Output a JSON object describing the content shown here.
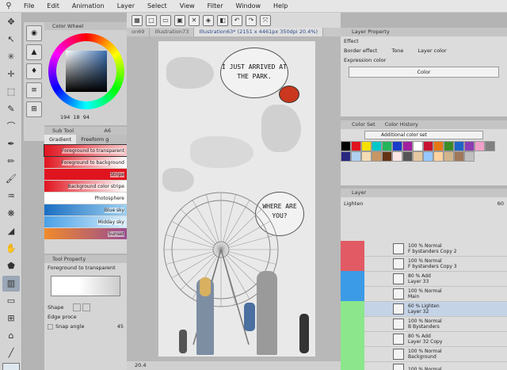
{
  "menubar": {
    "items": [
      "File",
      "Edit",
      "Animation",
      "Layer",
      "Select",
      "View",
      "Filter",
      "Window",
      "Help"
    ]
  },
  "canvas_tabs": [
    "on69",
    "Illustration73",
    "Illustration63* (2151 x 4461px 350dpi 20.4%)"
  ],
  "color_wheel": {
    "title": "Color Wheel",
    "h": "194",
    "s": "18",
    "v": "94"
  },
  "sub_tool": {
    "title": "Sub Tool",
    "tab_label": "A6",
    "tabs": [
      "Gradient",
      "Freeform g"
    ],
    "items": [
      {
        "label": "Foreground to transparent",
        "colors": [
          "#e0141e",
          "#f6c6c8"
        ]
      },
      {
        "label": "Foreground to background",
        "colors": [
          "#e0141e",
          "#ffffff"
        ]
      },
      {
        "label": "Stripe",
        "colors": [
          "#e0141e",
          "#e0141e"
        ]
      },
      {
        "label": "Background color stripe",
        "colors": [
          "#e0141e",
          "#ffffff"
        ]
      },
      {
        "label": "Photosphere",
        "colors": [
          "#ffffff",
          "#ffffff"
        ]
      },
      {
        "label": "Blue sky",
        "colors": [
          "#1a6fc2",
          "#9ed0f0"
        ]
      },
      {
        "label": "Midday sky",
        "colors": [
          "#4aa0e6",
          "#d8eefb"
        ]
      },
      {
        "label": "Sunset",
        "colors": [
          "#f08a2c",
          "#9a4c90"
        ]
      }
    ]
  },
  "tool_property": {
    "title": "Tool Property",
    "preset": "Foreground to transparent",
    "shape_label": "Shape",
    "edge_label": "Edge proce",
    "snap_label": "Snap angle",
    "snap_value": "45"
  },
  "layer_property": {
    "title": "Layer Property",
    "effect_label": "Effect",
    "border_effect": "Border effect",
    "tone": "Tone",
    "layer_color": "Layer color",
    "expression_label": "Expression color",
    "expression_value": "Color"
  },
  "color_set": {
    "tabs": [
      "Color Set",
      "Color History"
    ],
    "set_name": "Additional color set",
    "colors": [
      "#000000",
      "#e0141e",
      "#f5e100",
      "#00c8c8",
      "#24b45a",
      "#1a3cc8",
      "#a020a0",
      "#ffffff",
      "#c81432",
      "#e67814",
      "#3c8c28",
      "#1e64c8",
      "#8c3cb4",
      "#f0a0c8",
      "#808080",
      "#282880",
      "#b0d0f0",
      "#f5dcb4",
      "#c89664",
      "#643214",
      "#ffe6e6",
      "#555555",
      "#e6c8a0",
      "#96c8ff",
      "#ffd2a0",
      "#d2b48c",
      "#a0785a",
      "#c0c0c0"
    ]
  },
  "layers": {
    "title": "Layer",
    "blend_mode": "Lighten",
    "opacity": "60",
    "items": [
      {
        "line1": "100 % Normal",
        "line2": "F bystanders Copy 2",
        "vis": "#e15a64"
      },
      {
        "line1": "100 % Normal",
        "line2": "F bystanders Copy 3",
        "vis": "#e15a64"
      },
      {
        "line1": "80 % Add",
        "line2": "Layer 33",
        "vis": "#3c9be6"
      },
      {
        "line1": "100 % Normal",
        "line2": "Main",
        "vis": "#3c9be6"
      },
      {
        "line1": "60 % Lighten",
        "line2": "Layer 32",
        "vis": "#8ce68c"
      },
      {
        "line1": "100 % Normal",
        "line2": "B Bystanders",
        "vis": "#8ce68c"
      },
      {
        "line1": "80 % Add",
        "line2": "Layer 32 Copy",
        "vis": "#8ce68c"
      },
      {
        "line1": "100 % Normal",
        "line2": "Background",
        "vis": "#8ce68c"
      },
      {
        "line1": "100 % Normal",
        "line2": "",
        "vis": "#8ce68c"
      }
    ]
  },
  "canvas": {
    "bubble1": "I JUST ARRIVED AT THE PARK.",
    "bubble2": "WHERE ARE YOU?",
    "zoom": "20.4"
  }
}
